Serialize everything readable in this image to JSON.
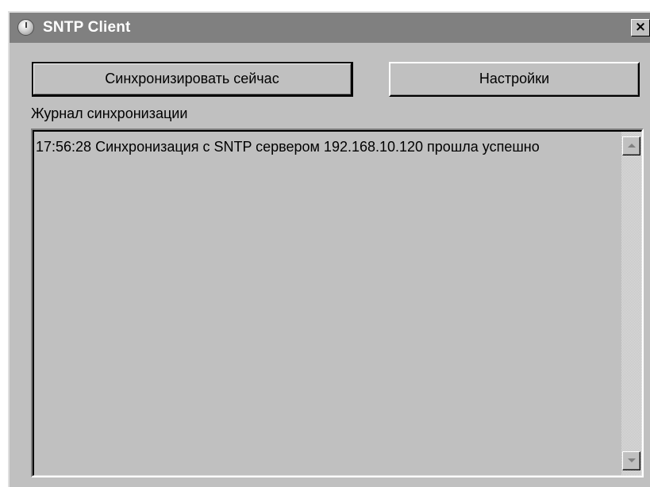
{
  "window": {
    "title": "SNTP Client",
    "close_label": "✕"
  },
  "icons": {
    "app": "clock-icon",
    "close": "close-icon",
    "scroll_up": "arrow-up-icon",
    "scroll_down": "arrow-down-icon"
  },
  "buttons": {
    "sync_label": "Синхронизировать сейчас",
    "settings_label": "Настройки"
  },
  "log": {
    "label": "Журнал синхронизации",
    "entries": [
      "17:56:28  Синхронизация с SNTP сервером 192.168.10.120 прошла успешно"
    ]
  },
  "colors": {
    "titlebar": "#808080",
    "window_face": "#c0c0c0",
    "title_text": "#ffffff"
  }
}
